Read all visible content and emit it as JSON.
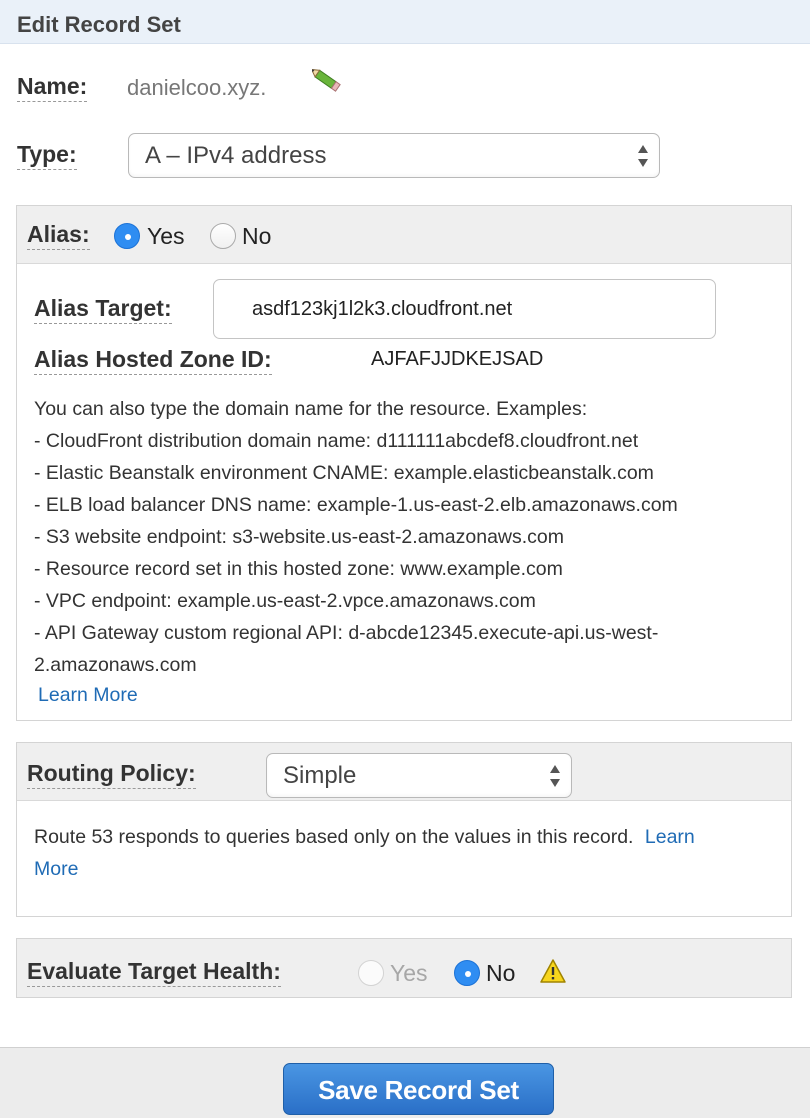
{
  "header": {
    "title": "Edit Record Set"
  },
  "name": {
    "label": "Name:",
    "value": "danielcoo.xyz."
  },
  "type": {
    "label": "Type:",
    "selected": "A – IPv4 address"
  },
  "alias": {
    "label": "Alias:",
    "yes_label": "Yes",
    "no_label": "No",
    "selected": "Yes",
    "target_label": "Alias Target:",
    "target_value": "asdf123kj1l2k3.cloudfront.net",
    "zone_label": "Alias Hosted Zone ID:",
    "zone_value": "AJFAFJJDKEJSAD",
    "help_intro": "You can also type the domain name for the resource. Examples:",
    "examples": [
      "-  CloudFront distribution domain name: d111111abcdef8.cloudfront.net",
      "-  Elastic Beanstalk environment CNAME: example.elasticbeanstalk.com",
      "-  ELB load balancer DNS name: example-1.us-east-2.elb.amazonaws.com",
      "-  S3 website endpoint: s3-website.us-east-2.amazonaws.com",
      "-  Resource record set in this hosted zone: www.example.com",
      "-  VPC endpoint: example.us-east-2.vpce.amazonaws.com",
      "-  API Gateway custom regional API: d-abcde12345.execute-api.us-west-",
      "2.amazonaws.com"
    ],
    "learn_more": "Learn More"
  },
  "routing": {
    "label": "Routing Policy:",
    "selected": "Simple",
    "description": "Route 53 responds to queries based only on the values in this record.",
    "learn_more_1": "Learn",
    "learn_more_2": "More"
  },
  "health": {
    "label": "Evaluate Target Health:",
    "yes_label": "Yes",
    "no_label": "No",
    "selected": "No"
  },
  "footer": {
    "save_label": "Save Record Set"
  },
  "icons": {
    "edit": "pencil-icon",
    "warning": "warning-icon",
    "select_arrows": "updown-arrows-icon"
  },
  "colors": {
    "link": "#1f6bb5",
    "radio_on": "#2f8df2",
    "save_button": "#2f7bd4",
    "header_bg": "#eaf1f9"
  }
}
